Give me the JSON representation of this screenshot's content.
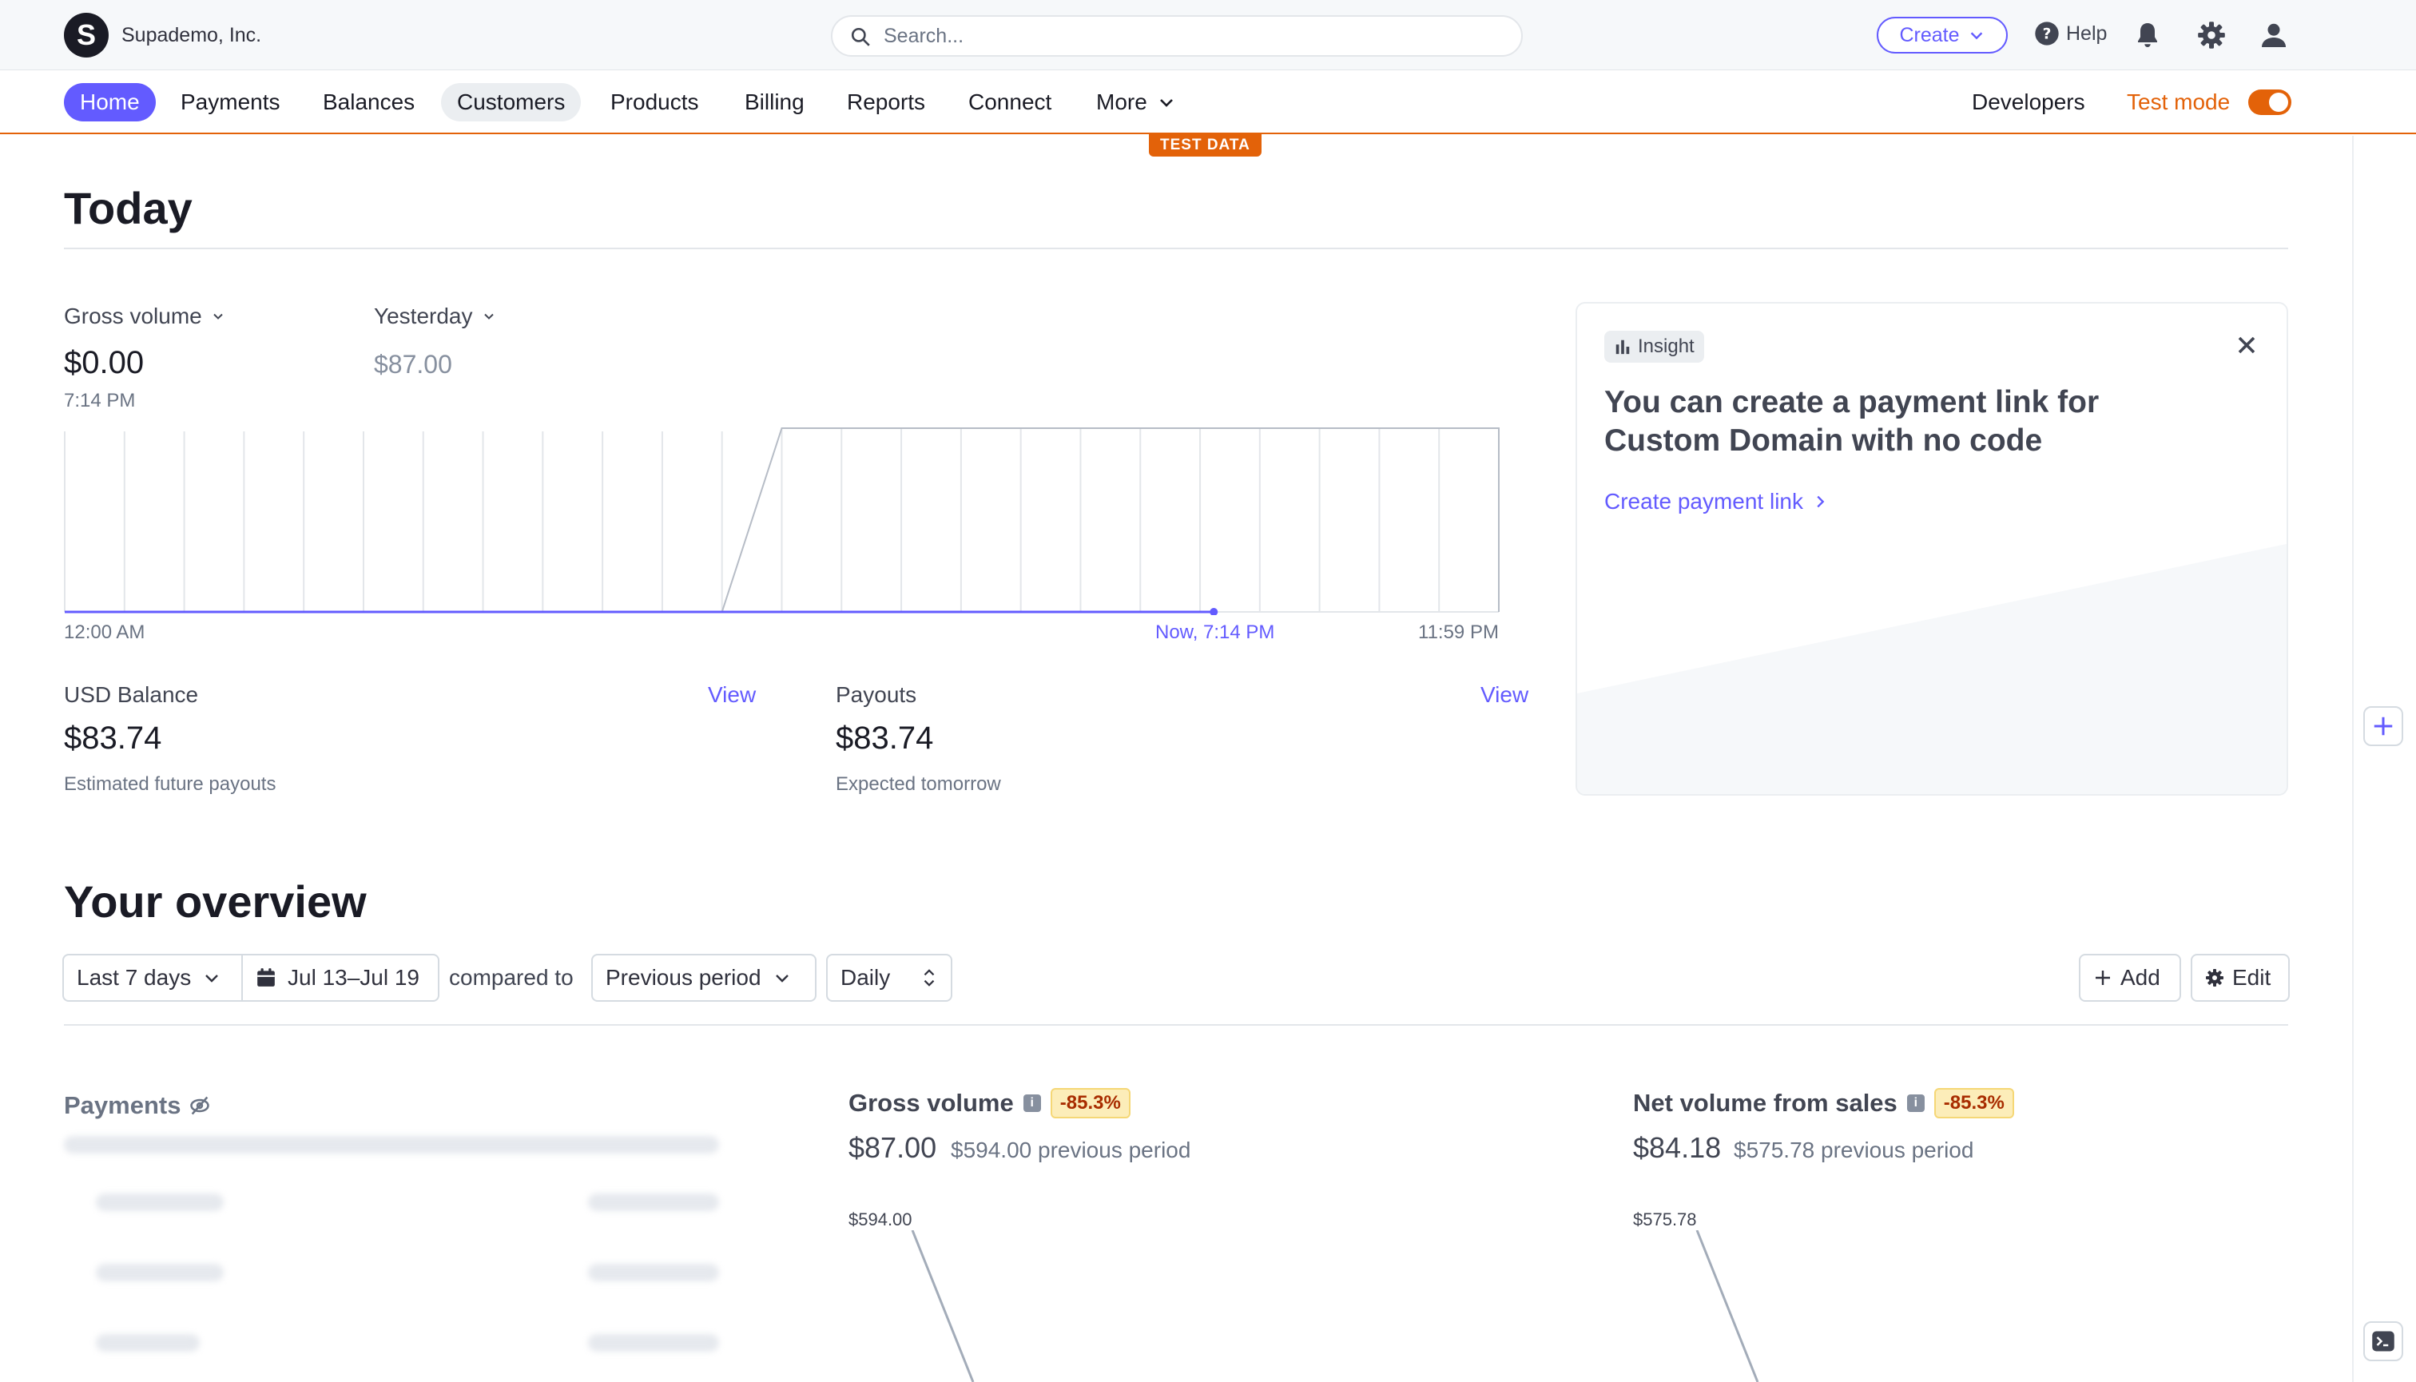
{
  "header": {
    "company": "Supademo, Inc.",
    "logo_letter": "S",
    "search_placeholder": "Search...",
    "create_label": "Create",
    "help_label": "Help"
  },
  "nav": {
    "items": [
      "Home",
      "Payments",
      "Balances",
      "Customers",
      "Products",
      "Billing",
      "Reports",
      "Connect",
      "More"
    ],
    "developers": "Developers",
    "test_mode": "Test mode",
    "test_data_badge": "TEST DATA"
  },
  "today": {
    "title": "Today",
    "gross_volume_label": "Gross volume",
    "gross_volume_value": "$0.00",
    "gross_volume_time": "7:14 PM",
    "compare_label": "Yesterday",
    "compare_value": "$87.00",
    "axis_start": "12:00 AM",
    "axis_now": "Now, 7:14 PM",
    "axis_end": "11:59 PM",
    "balance_label": "USD Balance",
    "balance_value": "$83.74",
    "balance_sub": "Estimated future payouts",
    "payouts_label": "Payouts",
    "payouts_value": "$83.74",
    "payouts_sub": "Expected tomorrow",
    "view_label": "View"
  },
  "insight": {
    "badge": "Insight",
    "title": "You can create a payment link for Custom Domain with no code",
    "link": "Create payment link"
  },
  "overview": {
    "title": "Your overview",
    "range": "Last 7 days",
    "dates": "Jul 13–Jul 19",
    "compared_to": "compared to",
    "comparison": "Previous period",
    "interval": "Daily",
    "add_label": "Add",
    "edit_label": "Edit",
    "payments_title": "Payments",
    "gross": {
      "title": "Gross volume",
      "change": "-85.3%",
      "value": "$87.00",
      "previous": "$594.00 previous period",
      "axis_top": "$594.00"
    },
    "net": {
      "title": "Net volume from sales",
      "change": "-85.3%",
      "value": "$84.18",
      "previous": "$575.78 previous period",
      "axis_top": "$575.78"
    }
  },
  "colors": {
    "accent": "#635bff",
    "test_mode": "#e36209",
    "badge_bg": "#fcedb9"
  },
  "chart_data": {
    "type": "line",
    "x": [
      "12:00 AM",
      "Now, 7:14 PM",
      "11:59 PM"
    ],
    "series": [
      {
        "values_today_to_now": [
          0,
          0
        ]
      },
      {
        "yesterday_cumulative": [
          0,
          0,
          87,
          87
        ]
      }
    ],
    "ylim": [
      0,
      87
    ]
  }
}
